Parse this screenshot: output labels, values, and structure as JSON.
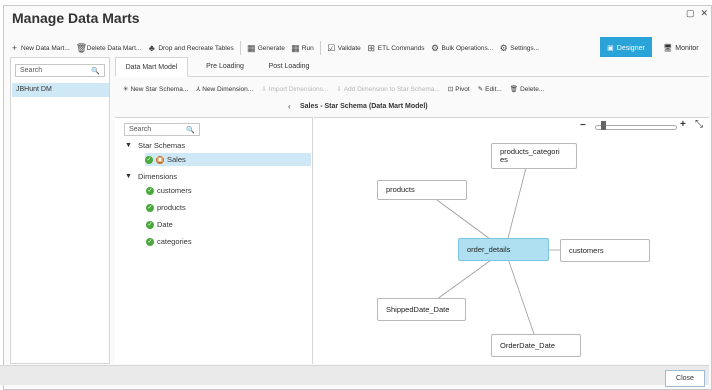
{
  "window": {
    "title": "Manage Data Marts",
    "restore_glyph": "▢",
    "close_glyph": "✕"
  },
  "toolbar": {
    "new_data_mart": "New Data Mart...",
    "delete_data_mart": "Delete Data Mart...",
    "drop_recreate": "Drop and Recreate Tables",
    "generate": "Generate",
    "run": "Run",
    "validate": "Validate",
    "etl_commands": "ETL Commands",
    "bulk_operations": "Bulk Operations...",
    "settings": "Settings...",
    "designer": "Designer",
    "monitor": "Monitor"
  },
  "left": {
    "search_placeholder": "Search",
    "items": [
      "JBHunt DM"
    ]
  },
  "tabs": [
    "Data Mart Model",
    "Pre Loading",
    "Post Loading"
  ],
  "subtoolbar": {
    "new_star_schema": "New Star Schema...",
    "new_dimension": "New Dimension...",
    "import_dimensions": "Import Dimensions...",
    "add_dimension": "Add Dimension to Star Schema...",
    "pivot": "Pivot",
    "edit": "Edit...",
    "delete": "Delete..."
  },
  "breadcrumb": "Sales - Star Schema (Data Mart Model)",
  "tree": {
    "search_placeholder": "Search",
    "star_schemas_label": "Star Schemas",
    "sales": "Sales",
    "dimensions_label": "Dimensions",
    "dimensions": [
      "customers",
      "products",
      "Date",
      "categories"
    ]
  },
  "diagram": {
    "center": "order_details",
    "nodes": {
      "products": "products",
      "products_categories": "products_categori\nes",
      "customers": "customers",
      "shipped": "ShippedDate_Date",
      "order_date": "OrderDate_Date"
    }
  },
  "zoom": {
    "minus": "−",
    "plus": "+",
    "fit": "⤡",
    "level": 0.05
  },
  "footer": {
    "close": "Close"
  }
}
